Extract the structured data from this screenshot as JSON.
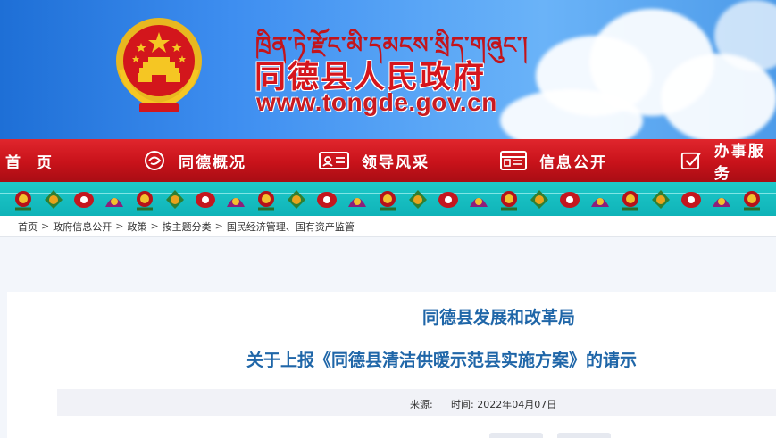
{
  "header": {
    "tibetan_title": "ཁྲིན་ཏེ་རྫོང་མི་དམངས་སྲིད་གཞུང་།",
    "site_title": "同德县人民政府",
    "site_url": "www.tongde.gov.cn"
  },
  "nav": {
    "items": [
      {
        "label": "首  页",
        "icon": "none"
      },
      {
        "label": "同德概况",
        "icon": "overview-icon"
      },
      {
        "label": "领导风采",
        "icon": "id-card-icon"
      },
      {
        "label": "信息公开",
        "icon": "info-board-icon"
      },
      {
        "label": "办事服务",
        "icon": "checkbox-icon"
      }
    ]
  },
  "breadcrumb": {
    "items": [
      "首页",
      "政府信息公开",
      "政策",
      "按主题分类",
      "国民经济管理、国有资产监管"
    ],
    "separator": ">"
  },
  "article": {
    "title_line1": "同德县发展和改革局",
    "title_line2": "关于上报《同德县清洁供暖示范县实施方案》的请示",
    "source_label": "来源:",
    "time_label": "时间:",
    "time_value": "2022年04月07日"
  },
  "colors": {
    "nav_red": "#c8121a",
    "title_blue": "#1f66a8",
    "band_teal": "#11b8bc",
    "header_blue": "#3e8ef0"
  }
}
